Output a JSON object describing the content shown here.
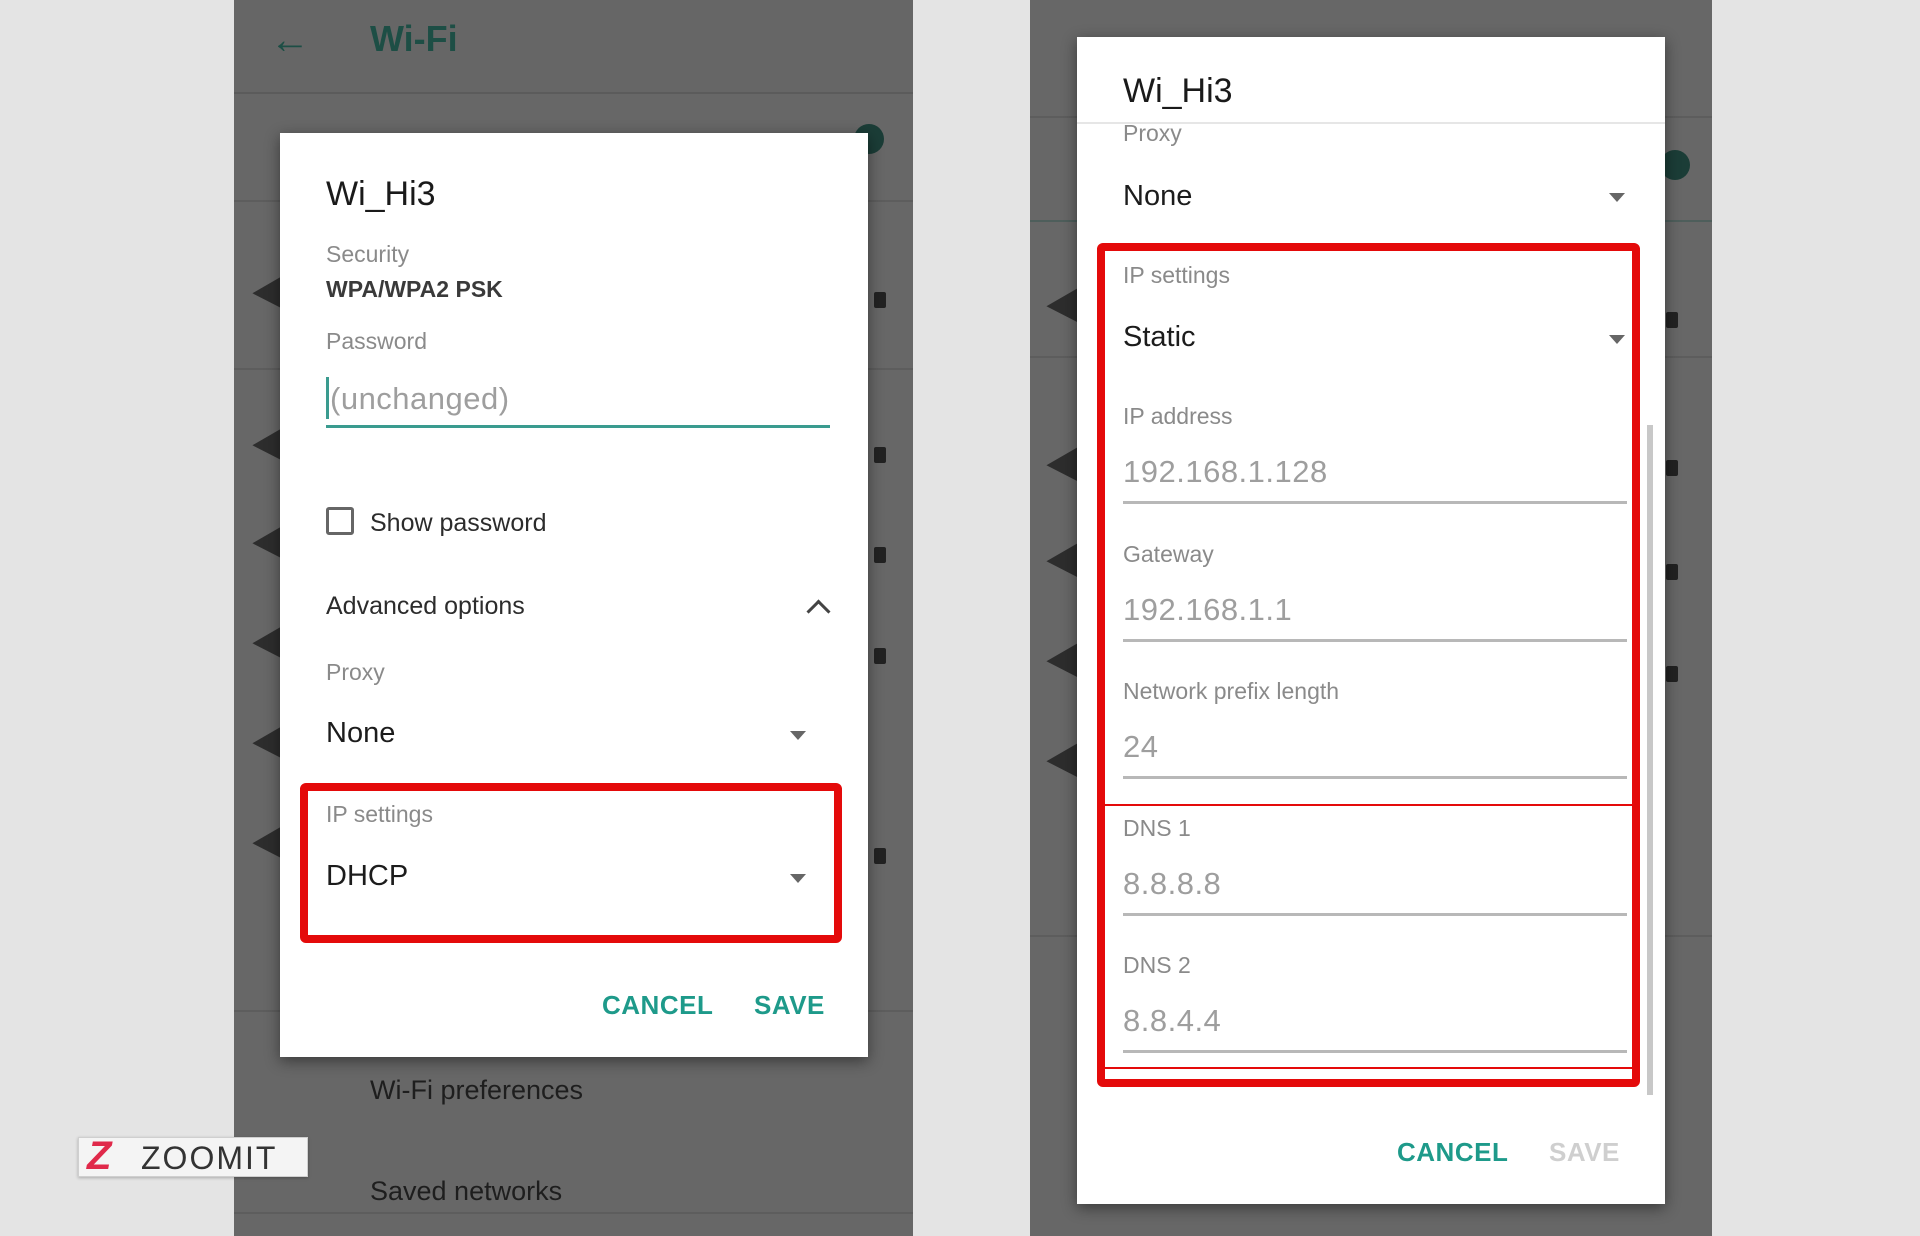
{
  "left_screen": {
    "toolbar": {
      "back_icon": "arrow-left-icon",
      "title": "Wi-Fi"
    },
    "background_items": [
      "Wi-Fi preferences",
      "Saved networks"
    ],
    "dialog": {
      "title": "Wi_Hi3",
      "security_label": "Security",
      "security_value": "WPA/WPA2 PSK",
      "password_label": "Password",
      "password_placeholder": "(unchanged)",
      "show_password_label": "Show password",
      "show_password_checked": false,
      "advanced_options_label": "Advanced options",
      "advanced_options_expanded": true,
      "proxy_label": "Proxy",
      "proxy_value": "None",
      "ip_settings_label": "IP settings",
      "ip_settings_value": "DHCP",
      "cancel_label": "CANCEL",
      "save_label": "SAVE"
    }
  },
  "right_screen": {
    "dialog": {
      "title": "Wi_Hi3",
      "proxy_label": "Proxy",
      "proxy_value": "None",
      "ip_settings_label": "IP settings",
      "ip_settings_value": "Static",
      "fields": [
        {
          "label": "IP address",
          "value": "192.168.1.128"
        },
        {
          "label": "Gateway",
          "value": "192.168.1.1"
        },
        {
          "label": "Network prefix length",
          "value": "24"
        },
        {
          "label": "DNS 1",
          "value": "8.8.8.8"
        },
        {
          "label": "DNS 2",
          "value": "8.8.4.4"
        }
      ],
      "cancel_label": "CANCEL",
      "save_label": "SAVE",
      "save_enabled": false
    }
  },
  "watermark": {
    "logo_icon": "zoomit-z-logo",
    "text": "ZOOMIT"
  },
  "colors": {
    "accent": "#1e9a8a",
    "highlight": "#e40a0a",
    "scrim": "#676767",
    "logo_red": "#e0294a"
  }
}
